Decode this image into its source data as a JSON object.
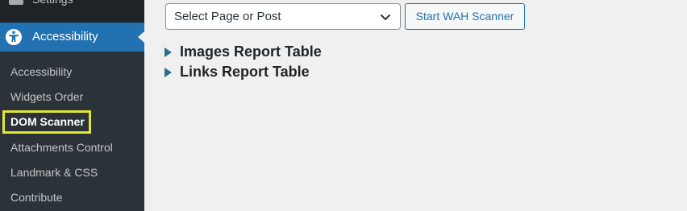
{
  "sidebar": {
    "previous_item_label": "Settings",
    "active_menu": {
      "label": "Accessibility",
      "icon": "universal-access-icon"
    },
    "submenu": [
      {
        "label": "Accessibility"
      },
      {
        "label": "Widgets Order"
      },
      {
        "label": "DOM Scanner",
        "current": true
      },
      {
        "label": "Attachments Control"
      },
      {
        "label": "Landmark & CSS"
      },
      {
        "label": "Contribute"
      }
    ]
  },
  "scanner": {
    "select_value": "Select Page or Post",
    "start_button_label": "Start WAH Scanner"
  },
  "reports": [
    {
      "label": "Images Report Table"
    },
    {
      "label": "Links Report Table"
    }
  ],
  "colors": {
    "sidebar_bg": "#1d2327",
    "submenu_bg": "#2c3338",
    "accent": "#2271b1",
    "highlight": "#e2e635"
  }
}
